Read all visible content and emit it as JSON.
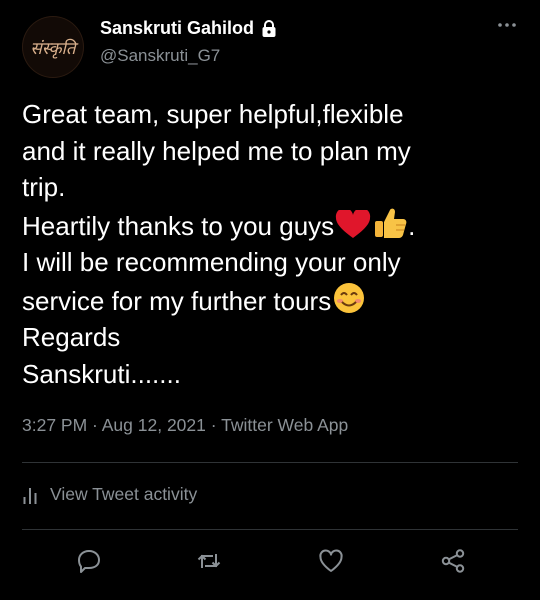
{
  "author": {
    "display_name": "Sanskruti Gahilod",
    "handle": "@Sanskruti_G7",
    "avatar_text": "संस्कृति"
  },
  "tweet": {
    "line1": "Great team, super helpful,flexible",
    "line2": "and it really helped me to plan my",
    "line3": "trip.",
    "line4": "Heartily thanks to you guys",
    "line4_end": ".",
    "line5": "I will be recommending your only",
    "line6": "service for my further tours",
    "line7": "Regards",
    "line8": "Sanskruti......."
  },
  "meta": {
    "timestamp": "3:27 PM · Aug 12, 2021 · Twitter Web App"
  },
  "activity": {
    "label": "View Tweet activity"
  },
  "icons": [
    "lock-icon",
    "more-icon",
    "heart-emoji",
    "thumbs-up-emoji",
    "smiling-emoji",
    "bar-chart-icon",
    "reply-icon",
    "retweet-icon",
    "like-icon",
    "share-icon"
  ],
  "colors": {
    "background": "#000000",
    "text": "#ffffff",
    "secondary_text": "#8b9196",
    "divider": "#2f3336"
  }
}
